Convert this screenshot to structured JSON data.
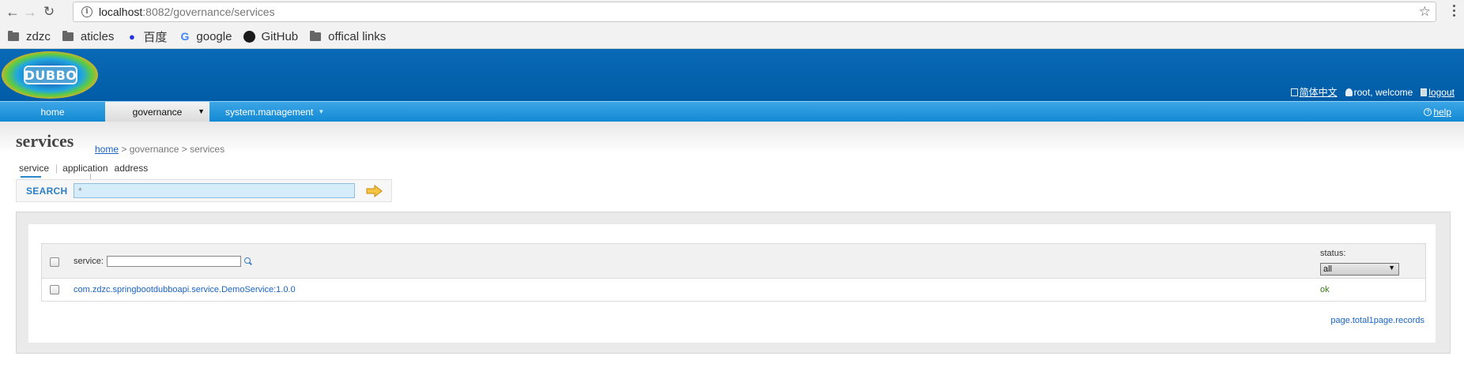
{
  "browser": {
    "url_host": "localhost",
    "url_path": ":8082/governance/services",
    "bookmarks": [
      "zdzc",
      "aticles",
      "百度",
      "google",
      "GitHub",
      "offical links"
    ]
  },
  "header": {
    "logo_text": "DUBBO",
    "lang_link": "简体中文",
    "user_text": "root, welcome",
    "logout_link": "logout"
  },
  "nav": {
    "home": "home",
    "governance": "governance",
    "system": "system.management",
    "help": "help"
  },
  "page": {
    "title": "services",
    "breadcrumb": {
      "home": "home",
      "rest": " > governance > services"
    },
    "tabs": [
      "service",
      "application",
      "address"
    ]
  },
  "search": {
    "label": "SEARCH",
    "value": "*"
  },
  "table": {
    "filter_label": "service:",
    "status_label": "status:",
    "status_selected": "all",
    "rows": [
      {
        "service": "com.zdzc.springbootdubboapi.service.DemoService:1.0.0",
        "status": "ok"
      }
    ],
    "pager": "page.total1page.records"
  },
  "colors": {
    "header_blue": "#005ca6",
    "nav_blue": "#1189d3",
    "link_blue": "#1a63c4",
    "status_ok": "#3a7a16"
  }
}
